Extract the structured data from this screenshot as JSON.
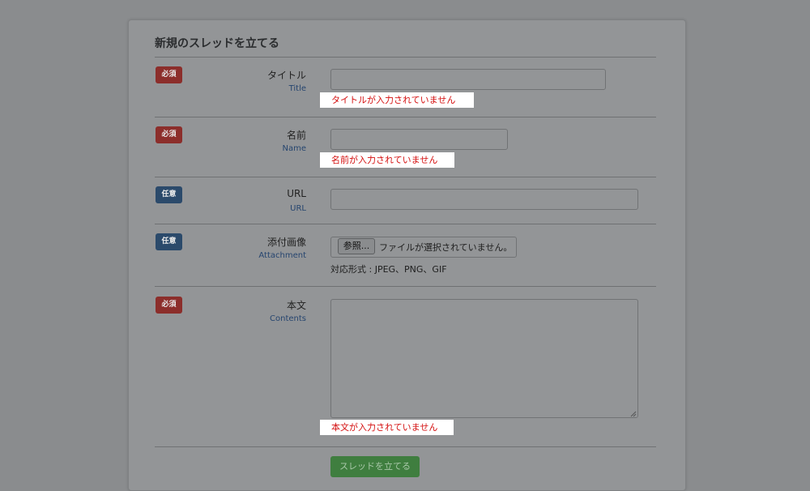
{
  "form": {
    "title": "新規のスレッドを立てる",
    "fields": {
      "title": {
        "badge": "必須",
        "label": "タイトル",
        "label_en": "Title",
        "error": "タイトルが入力されていません",
        "value": ""
      },
      "name": {
        "badge": "必須",
        "label": "名前",
        "label_en": "Name",
        "error": "名前が入力されていません",
        "value": ""
      },
      "url": {
        "badge": "任意",
        "label": "URL",
        "label_en": "URL",
        "value": ""
      },
      "attachment": {
        "badge": "任意",
        "label": "添付画像",
        "label_en": "Attachment",
        "browse_label": "参照...",
        "file_status": "ファイルが選択されていません。",
        "formats": "対応形式 : JPEG、PNG、GIF"
      },
      "contents": {
        "badge": "必須",
        "label": "本文",
        "label_en": "Contents",
        "error": "本文が入力されていません",
        "value": ""
      }
    },
    "submit_label": "スレッドを立てる"
  },
  "colors": {
    "required_badge": "#d9534f",
    "optional_badge": "#337ab7",
    "error_text": "#e00000",
    "submit_button": "#5cb85c",
    "label_en": "#2a5aa0"
  }
}
